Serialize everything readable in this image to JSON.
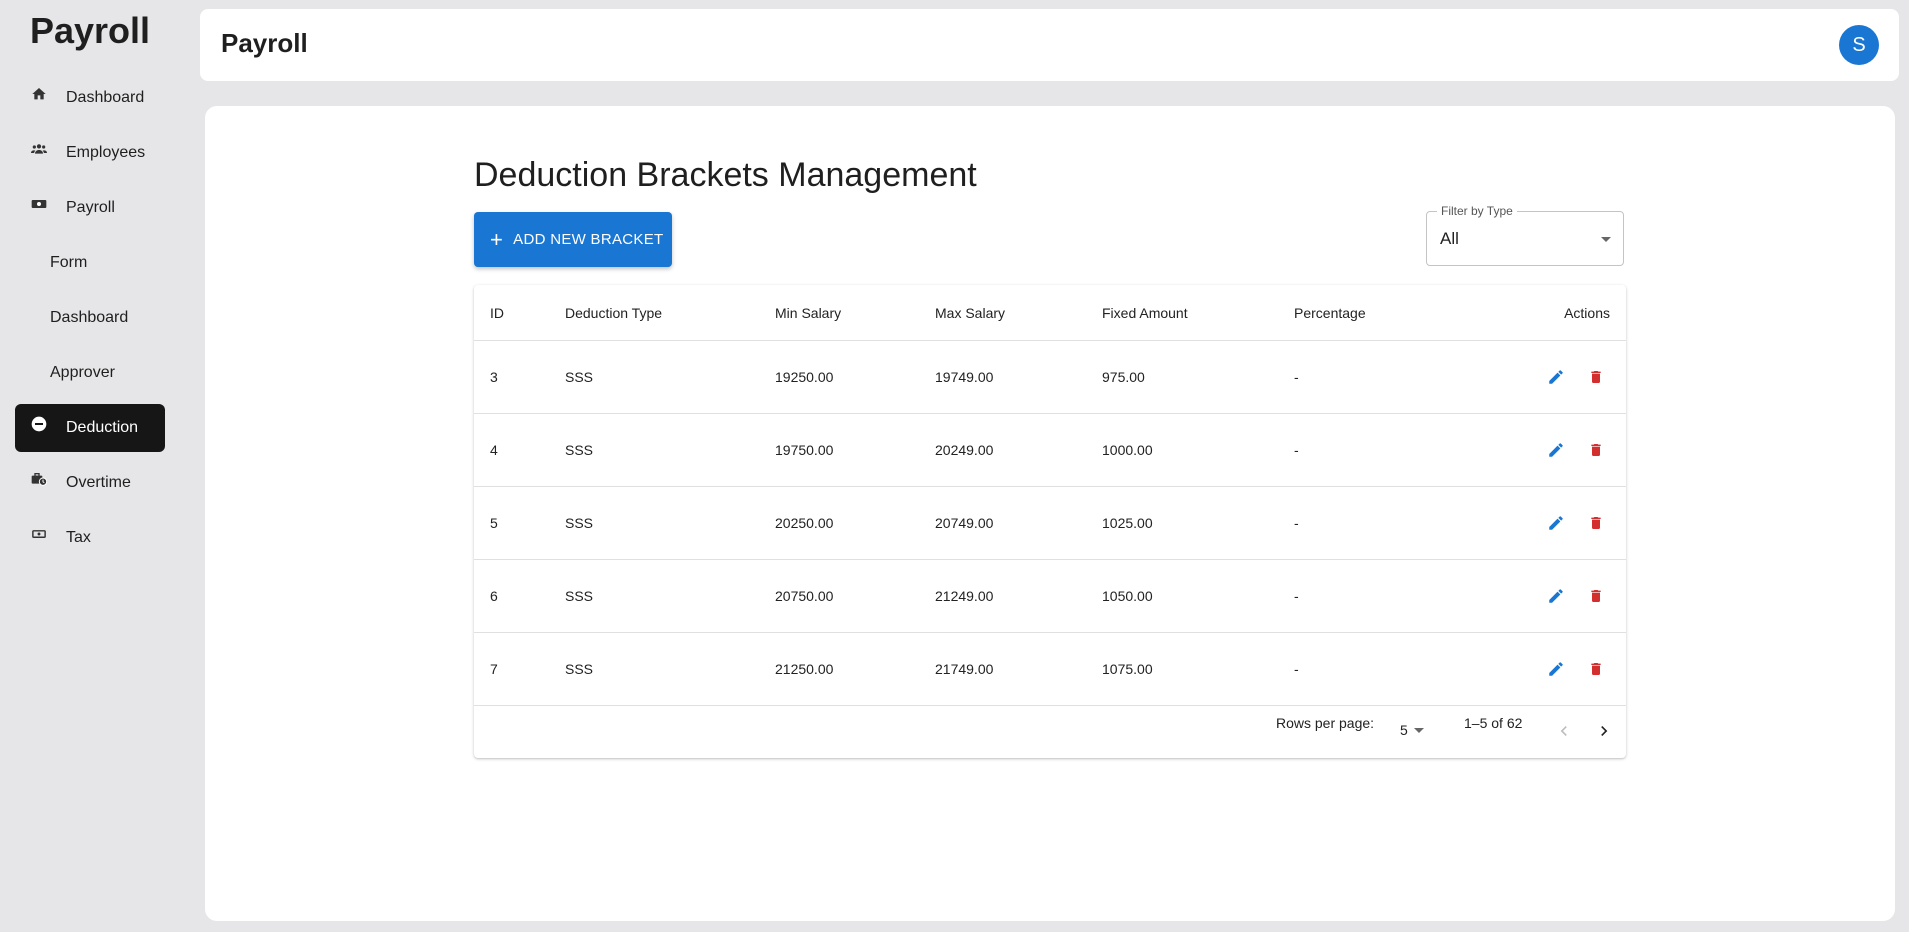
{
  "sidebar": {
    "brand": "Payroll",
    "items": [
      {
        "label": "Dashboard",
        "icon": "home-icon"
      },
      {
        "label": "Employees",
        "icon": "people-icon"
      },
      {
        "label": "Payroll",
        "icon": "cash-icon"
      },
      {
        "label": "Form"
      },
      {
        "label": "Dashboard"
      },
      {
        "label": "Approver"
      },
      {
        "label": "Deduction",
        "icon": "minus-circle-icon",
        "active": true
      },
      {
        "label": "Overtime",
        "icon": "briefcase-clock-icon"
      },
      {
        "label": "Tax",
        "icon": "money-icon"
      }
    ]
  },
  "header": {
    "title": "Payroll",
    "avatar_initial": "S"
  },
  "main": {
    "title": "Deduction Brackets Management",
    "add_button_label": "ADD NEW BRACKET",
    "filter": {
      "label": "Filter by Type",
      "value": "All"
    },
    "table": {
      "headers": [
        "ID",
        "Deduction Type",
        "Min Salary",
        "Max Salary",
        "Fixed Amount",
        "Percentage",
        "Actions"
      ],
      "rows": [
        {
          "id": "3",
          "type": "SSS",
          "min": "19250.00",
          "max": "19749.00",
          "fixed": "975.00",
          "pct": "-"
        },
        {
          "id": "4",
          "type": "SSS",
          "min": "19750.00",
          "max": "20249.00",
          "fixed": "1000.00",
          "pct": "-"
        },
        {
          "id": "5",
          "type": "SSS",
          "min": "20250.00",
          "max": "20749.00",
          "fixed": "1025.00",
          "pct": "-"
        },
        {
          "id": "6",
          "type": "SSS",
          "min": "20750.00",
          "max": "21249.00",
          "fixed": "1050.00",
          "pct": "-"
        },
        {
          "id": "7",
          "type": "SSS",
          "min": "21250.00",
          "max": "21749.00",
          "fixed": "1075.00",
          "pct": "-"
        }
      ]
    },
    "pagination": {
      "rows_per_page_label": "Rows per page:",
      "rows_per_page_value": "5",
      "range_label": "1–5 of 62"
    }
  },
  "colors": {
    "primary": "#1976d2",
    "danger": "#d32f2f",
    "active_nav": "#161616"
  }
}
